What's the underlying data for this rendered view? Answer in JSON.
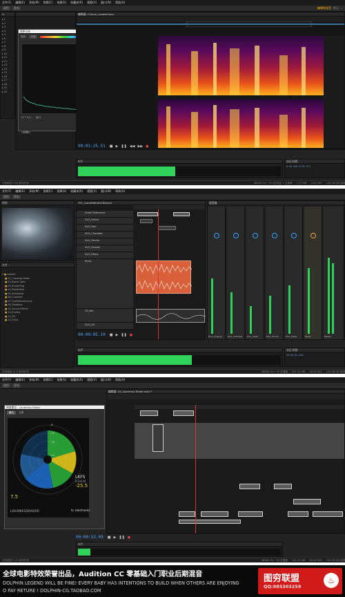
{
  "banner": {
    "title_cn": "全球电影特效荣誉出品，Audition CC 零基础入门职业后期混音",
    "tagline_line1": "DOLPHIN LEGEND WILL BE FINE! EVERY BABY HAS INTENTIONS TO BUILD WHEN OTHERS ARE ENJOYING",
    "tagline_line2": "O PAY RETURE ! DOLPHIN-CG.TAOBAO.COM",
    "logo_title": "图穷联盟",
    "logo_qq": "QQ:985303259"
  },
  "win1": {
    "menu": [
      "文件(F)",
      "编辑(E)",
      "多轨(M)",
      "剪辑(C)",
      "效果(S)",
      "收藏夹(R)",
      "视图(V)",
      "窗口(W)",
      "帮助(H)"
    ],
    "toolbar": [
      "波形",
      "多轨"
    ],
    "workspace_tabs": [
      {
        "label": "编辑和混音",
        "active": true
      },
      {
        "label": "默认",
        "active": false
      }
    ],
    "effect_window_title": "频率分析",
    "effect_labels": [
      "缩放:",
      "对数",
      "FFT 大小:",
      "窗口:",
      "扫描"
    ],
    "time": "00:01:25.51",
    "meter_label": "电平",
    "sel_title": "选区/视图",
    "status": [
      "已完成在 0.02 秒内打开",
      "48000 Hz • 32 位(浮点) • 立体声",
      "1.57 MB",
      "0:04.191",
      "119.39 GB 空闲"
    ]
  },
  "win2": {
    "menu": [
      "文件(F)",
      "编辑(E)",
      "多轨(M)",
      "剪辑(C)",
      "效果(S)",
      "收藏夹(R)",
      "视图(V)",
      "窗口(W)",
      "帮助(H)"
    ],
    "toolbar": [
      "波形",
      "多轨"
    ],
    "video_panel": "视频",
    "files_panel": "文件",
    "session_tab": "*01_LoadedBreathTexture",
    "mixer_tab": "混音器",
    "tracks": [
      "Video Reference",
      "DLG_Scene",
      "DLG_Hair",
      "DLG_Chamber",
      "DLG_Studio",
      "DLG_Guests",
      "DLG_Steps",
      "Music",
      "FX_Mix",
      "DLG_Fill"
    ],
    "folders": [
      "Loaded",
      "01_Crashing Holes",
      "02_Barrel Gate",
      "03_Shoot Flag",
      "04_Breathless",
      "05_Reloading",
      "06_Chamber",
      "07_FeelDisturbances",
      "08_Goodbye",
      "09_Sound Effects",
      "10_Ending",
      "11_Fill",
      "12_Extra"
    ],
    "mixer_strips": [
      "DLG_Closeup",
      "DLG_Chamber",
      "DLG_Ideas",
      "DLG_Clouds",
      "DLG_Steps",
      "Music",
      "Master"
    ],
    "time": "00:00:05.10",
    "meter_label": "电平",
    "status": [
      "已完成在 0.17 秒内打开",
      "48000 Hz • 32 位混音",
      "301.54 MB",
      "00:04.000",
      "119.39 GB 空闲"
    ]
  },
  "win3": {
    "menu": [
      "文件(F)",
      "编辑(E)",
      "多轨(M)",
      "剪辑(C)",
      "效果(S)",
      "收藏夹(R)",
      "视图(V)",
      "窗口(W)",
      "帮助(H)"
    ],
    "toolbar": [
      "波形",
      "多轨"
    ],
    "radar_title": "响度雷达 - Loudness Radar",
    "radar_tabs": [
      "雷达",
      "设置"
    ],
    "radar_logo": "LOUDNESSRADAR",
    "radar_brand": "tc electronic",
    "radar_unit": "LKFS",
    "radar_value": "-25.5",
    "radar_small": "7.5",
    "radar_range": "0:24:44",
    "ring_labels": [
      "-24",
      "-18",
      "-12",
      "-6",
      "0"
    ],
    "session_tab": "编辑器: 02_Loudness Radar.sesx *",
    "time": "00:00:53.09",
    "meter_label": "电平",
    "status": [
      "已完成在 0.11 秒内打开",
      "48000 Hz • 32 位混音",
      "101.22 MB",
      "00:04.000",
      "119.39 GB 空闲"
    ]
  },
  "colors": {
    "accent": "#4aa8ff",
    "meter": "#2fd35a",
    "playhead": "#d33333",
    "banner_logo": "#d11a1a"
  }
}
